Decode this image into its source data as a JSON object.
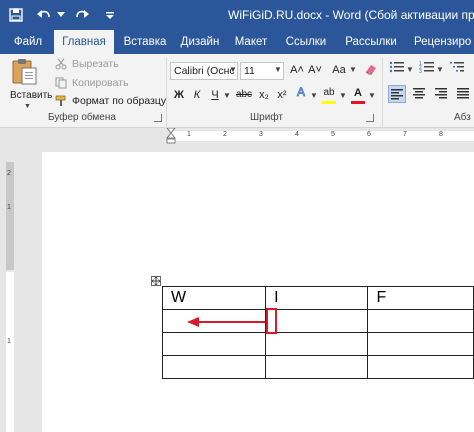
{
  "window": {
    "title": "WiFiGiD.RU.docx - Word (Сбой активации проду"
  },
  "quick_access": [
    "save-icon",
    "undo-icon",
    "undo-dropdown-icon",
    "redo-icon",
    "customize-icon"
  ],
  "tabs": [
    {
      "label": "Файл",
      "active": false
    },
    {
      "label": "Главная",
      "active": true
    },
    {
      "label": "Вставка",
      "active": false
    },
    {
      "label": "Дизайн",
      "active": false
    },
    {
      "label": "Макет",
      "active": false
    },
    {
      "label": "Ссылки",
      "active": false
    },
    {
      "label": "Рассылки",
      "active": false
    },
    {
      "label": "Рецензиро",
      "active": false
    }
  ],
  "clipboard": {
    "paste_label": "Вставить",
    "cut_label": "Вырезать",
    "copy_label": "Копировать",
    "format_painter_label": "Формат по образцу",
    "group_label": "Буфер обмена"
  },
  "font": {
    "font_name": "Calibri (Оснс",
    "font_size": "11",
    "grow": "A˄",
    "shrink": "A˅",
    "case": "Aa",
    "bold": "Ж",
    "italic": "К",
    "underline": "Ч",
    "strike": "abc",
    "subscript": "x₂",
    "superscript": "x²",
    "font_color_letter": "A",
    "highlight_letter": "ab",
    "group_label": "Шрифт"
  },
  "paragraph": {
    "group_label": "Абз"
  },
  "ruler": {
    "top_numbers": [
      "1",
      "2",
      "3",
      "4",
      "5",
      "6",
      "7",
      "8"
    ],
    "side_numbers": [
      "1",
      "2",
      "1"
    ]
  },
  "table": {
    "rows": [
      [
        "W",
        "I",
        "F"
      ],
      [
        "",
        "",
        ""
      ],
      [
        "",
        "",
        ""
      ],
      [
        "",
        "",
        ""
      ]
    ]
  },
  "colors": {
    "brand": "#2b579a",
    "annotation": "#d81b2a",
    "font_color_bar": "#e81123",
    "highlight_bar": "#ffff00"
  }
}
